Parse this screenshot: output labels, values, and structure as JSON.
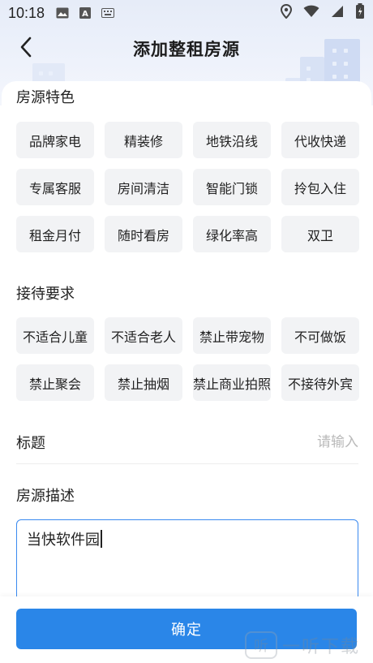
{
  "status_bar": {
    "time": "10:18",
    "left_icons": [
      "image-icon",
      "a-letter-icon",
      "keyboard-icon"
    ],
    "right_icons": [
      "location-icon",
      "wifi-icon",
      "battery-icon"
    ]
  },
  "header": {
    "title": "添加整租房源",
    "back_icon": "chevron-left-icon"
  },
  "features": {
    "title": "房源特色",
    "items": [
      "品牌家电",
      "精装修",
      "地铁沿线",
      "代收快递",
      "专属客服",
      "房间清洁",
      "智能门锁",
      "拎包入住",
      "租金月付",
      "随时看房",
      "绿化率高",
      "双卫"
    ]
  },
  "requirements": {
    "title": "接待要求",
    "items": [
      "不适合儿童",
      "不适合老人",
      "禁止带宠物",
      "不可做饭",
      "禁止聚会",
      "禁止抽烟",
      "禁止商业拍照",
      "不接待外宾"
    ]
  },
  "title_field": {
    "label": "标题",
    "placeholder": "请输入"
  },
  "description": {
    "label": "房源描述",
    "value": "当快软件园"
  },
  "footer": {
    "confirm_label": "确定"
  },
  "watermark": {
    "logo_char": "听",
    "text": "一听下载"
  },
  "colors": {
    "accent": "#2a86e8",
    "chip_bg": "#f2f3f5",
    "header_bg": "#e6ecf8"
  }
}
